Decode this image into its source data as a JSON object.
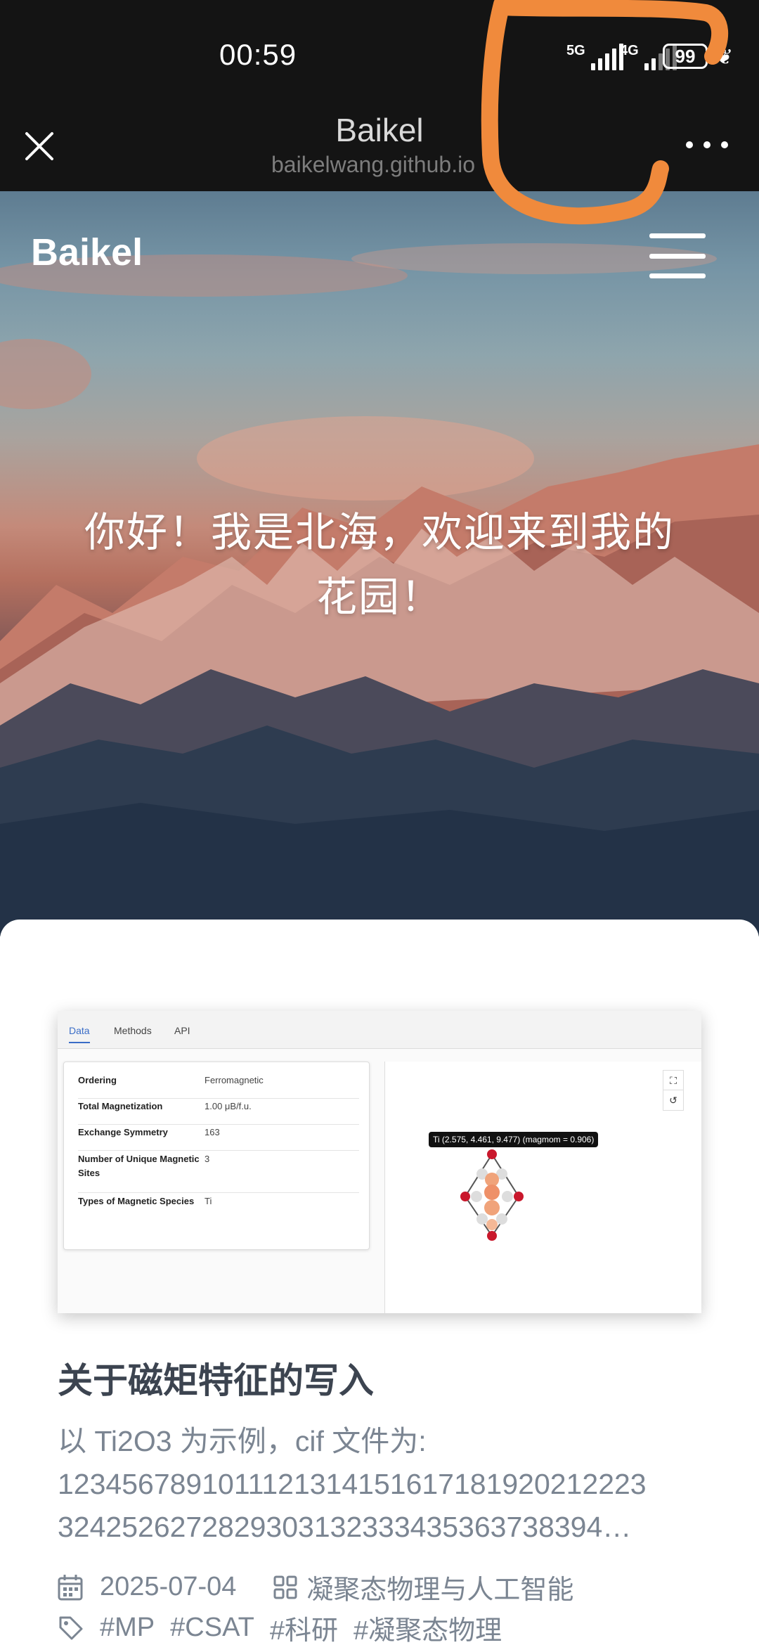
{
  "status_bar": {
    "time": "00:59",
    "network_1": "5G",
    "network_2": "4G",
    "battery": "99"
  },
  "browser": {
    "title": "Baikel",
    "url": "baikelwang.github.io",
    "close_icon": "close-icon",
    "more_icon": "more-dots-icon"
  },
  "site": {
    "brand": "Baikel",
    "menu_icon": "hamburger-menu-icon",
    "hero_line_1": "你好！我是北海，欢迎来到我的",
    "hero_line_2": "花园！"
  },
  "post": {
    "preview": {
      "tabs": [
        "Data",
        "Methods",
        "API"
      ],
      "rows": [
        {
          "key": "Ordering",
          "value": "Ferromagnetic"
        },
        {
          "key": "Total Magnetization",
          "value": "1.00 μB/f.u."
        },
        {
          "key": "Exchange Symmetry",
          "value": "163"
        },
        {
          "key": "Number of Unique Magnetic Sites",
          "value": "3"
        },
        {
          "key": "Types of Magnetic Species",
          "value": "Ti"
        }
      ],
      "tooltip": "Ti (2.575, 4.461, 9.477) (magmom = 0.906)"
    },
    "title": "关于磁矩特征的写入",
    "excerpt_line_1": "以 Ti2O3 为示例，cif 文件为:",
    "excerpt_line_2": "1234567891011121314151617181920212223",
    "excerpt_line_3": "3242526272829303132333435363738394…",
    "date": "2025-07-04",
    "category": "凝聚态物理与人工智能",
    "tags": [
      "#MP",
      "#CSAT",
      "#科研",
      "#凝聚态物理"
    ]
  },
  "colors": {
    "annotation": "#f08a3c",
    "title": "#3c4450",
    "muted": "#7b8592"
  }
}
